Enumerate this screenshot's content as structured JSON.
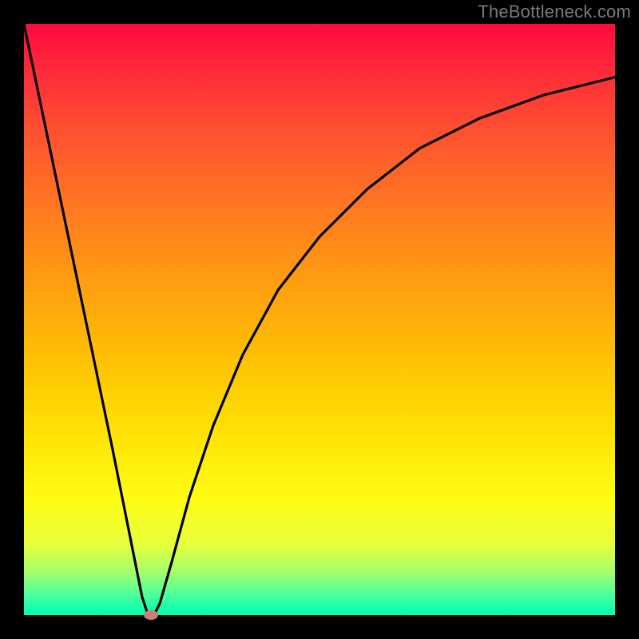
{
  "brand": "TheBottleneck.com",
  "chart_data": {
    "type": "line",
    "title": "",
    "xlabel": "",
    "ylabel": "",
    "xlim": [
      0,
      100
    ],
    "ylim": [
      0,
      100
    ],
    "grid": false,
    "legend": false,
    "series": [
      {
        "name": "curve",
        "x": [
          0,
          5,
          10,
          15,
          18,
          20,
          21,
          22,
          23,
          25,
          28,
          32,
          37,
          43,
          50,
          58,
          67,
          77,
          88,
          100
        ],
        "values": [
          100,
          76,
          52,
          28,
          13,
          3,
          0,
          0,
          2,
          9,
          20,
          32,
          44,
          55,
          64,
          72,
          79,
          84,
          88,
          91
        ]
      }
    ],
    "marker": {
      "x": 21.5,
      "y": 0
    },
    "background_gradient": [
      "#ff0a3f",
      "#ff9912",
      "#fffc12",
      "#00ffb0"
    ],
    "colors": {
      "curve": "#000000",
      "marker": "#cc7d77",
      "frame": "#000000"
    }
  }
}
